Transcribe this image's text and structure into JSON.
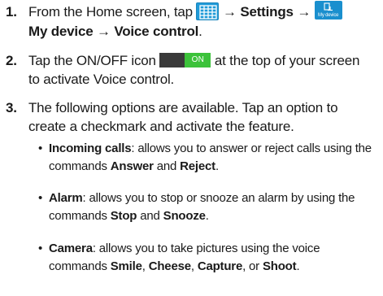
{
  "steps": [
    {
      "number": "1.",
      "line1_pre": "From the Home screen, tap ",
      "arrow": "→",
      "settings": "Settings",
      "mydevice_caption": "My device",
      "mydevice": "My device",
      "voice_control": "Voice control",
      "period": "."
    },
    {
      "number": "2.",
      "pre": "Tap the ON/OFF icon ",
      "toggle_label": "ON",
      "post_line1": " at the top of your screen",
      "line2": "to activate Voice control."
    },
    {
      "number": "3.",
      "line1": "The following options are available. Tap an option to",
      "line2": "create a checkmark and activate the feature."
    }
  ],
  "bullets": [
    {
      "term": "Incoming calls",
      "line1_rest": ": allows you to answer or reject calls using the",
      "line2_pre": "commands ",
      "k1": "Answer",
      "and": " and ",
      "k2": "Reject",
      "end": "."
    },
    {
      "term": "Alarm",
      "line1_rest": ": allows you to stop or snooze an alarm by using the",
      "line2_pre": "commands ",
      "k1": "Stop",
      "and": " and ",
      "k2": "Snooze",
      "end": "."
    },
    {
      "term": "Camera",
      "line1_rest": ": allows you to take pictures using the voice",
      "line2_pre": "commands ",
      "k1": "Smile",
      "sep1": ", ",
      "k2": "Cheese",
      "sep2": ", ",
      "k3": "Capture",
      "or": ", or ",
      "k4": "Shoot",
      "end": "."
    }
  ],
  "bullet_symbol": "•",
  "icons": {
    "apps": "apps-grid-icon",
    "mydevice": "my-device-icon",
    "toggle": "on-off-toggle-icon"
  },
  "colors": {
    "apps_icon": "#1f9ad8",
    "mydevice_icon": "#1a8fce",
    "toggle_off": "#3a3a3a",
    "toggle_on": "#3cc23a"
  }
}
